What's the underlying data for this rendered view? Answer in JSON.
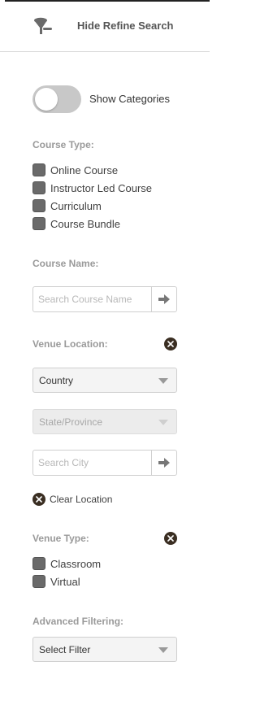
{
  "header": {
    "hide_label": "Hide Refine Search",
    "icon": "funnel-icon"
  },
  "categories_toggle": {
    "label": "Show Categories",
    "on": false
  },
  "course_type": {
    "title": "Course Type:",
    "options": [
      {
        "label": "Online Course"
      },
      {
        "label": "Instructor Led Course"
      },
      {
        "label": "Curriculum"
      },
      {
        "label": "Course Bundle"
      }
    ]
  },
  "course_name": {
    "title": "Course Name:",
    "placeholder": "Search Course Name"
  },
  "venue_location": {
    "title": "Venue Location:",
    "country": "Country",
    "state": "State/Province",
    "city_placeholder": "Search City",
    "clear_label": "Clear Location"
  },
  "venue_type": {
    "title": "Venue Type:",
    "options": [
      {
        "label": "Classroom"
      },
      {
        "label": "Virtual"
      }
    ]
  },
  "advanced": {
    "title": "Advanced Filtering:",
    "select_value": "Select Filter"
  },
  "colors": {
    "accent_dark": "#3a2e22",
    "checkbox": "#6a6a6a",
    "label_gray": "#9a9a9a"
  }
}
